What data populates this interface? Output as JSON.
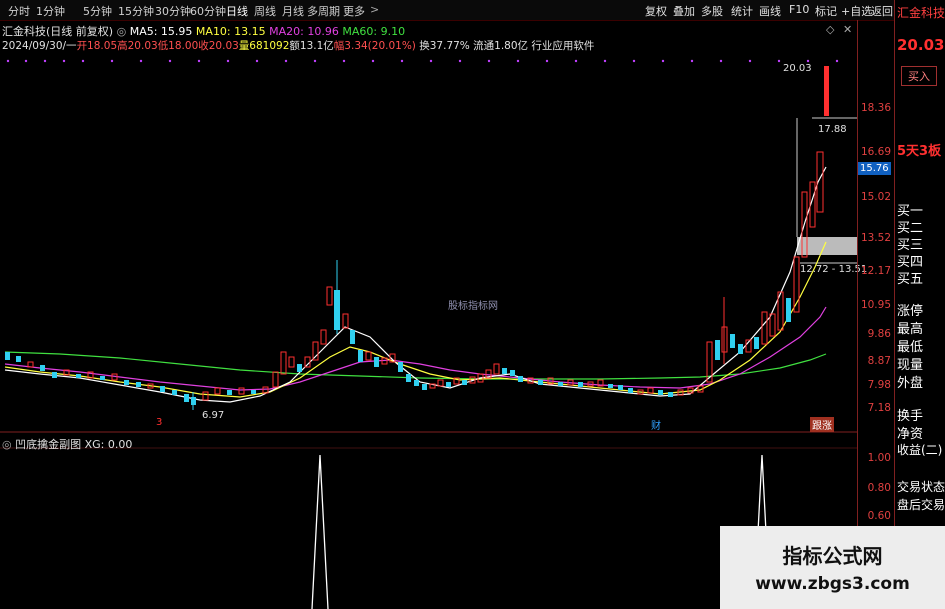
{
  "toolbar": {
    "timeframes": [
      "分时",
      "1分钟",
      "5分钟",
      "15分钟",
      "30分钟",
      "60分钟",
      "日线",
      "周线",
      "月线",
      "多周期",
      "更多"
    ],
    "active_timeframe": "日线",
    "buttons": [
      "复权",
      "叠加",
      "多股",
      "统计",
      "画线",
      "F10",
      "标记",
      "+自选",
      "返回"
    ]
  },
  "stock": {
    "name": "汇金科技",
    "period_label": "(日线 前复权)",
    "ma5": "MA5: 15.95",
    "ma10": "MA10: 13.15",
    "ma20": "MA20: 10.96",
    "ma60": "MA60: 9.10"
  },
  "stats": {
    "date": "2024/09/30/一",
    "open": "开18.05",
    "high": "高20.03",
    "low": "低18.00",
    "close": "收20.03",
    "volume": "量681092",
    "amount": "额13.1亿",
    "change": "幅3.34(20.01%)",
    "turnover": "换37.77%",
    "float_cap": "流通1.80亿",
    "industry": "行业应用软件"
  },
  "chart_labels": {
    "center_watermark": "股标指标网",
    "peak_label": "20.03",
    "low_label": "6.97",
    "box_upper": "17.88",
    "box_lower": "12.72 - 13.51",
    "current_price_tag": "15.76",
    "marker_left": "3",
    "marker_fin": "财",
    "marker_limit": "跟涨"
  },
  "price_axis": [
    "18.36",
    "16.69",
    "15.02",
    "13.52",
    "12.17",
    "10.95",
    "9.86",
    "8.87",
    "7.98",
    "7.18"
  ],
  "indicator": {
    "name": "凹底擒金副图",
    "value": "XG: 0.00",
    "axis": [
      "1.00",
      "0.80",
      "0.60"
    ]
  },
  "right_panel": {
    "stock_name": "汇金科技",
    "price": "20.03",
    "buy_button": "买入",
    "streak": "5天3板",
    "levels": [
      "买一",
      "买二",
      "买三",
      "买四",
      "买五"
    ],
    "fields": [
      "涨停",
      "最高",
      "最低",
      "现量",
      "外盘"
    ],
    "fields2": [
      "换手",
      "净资",
      "收益(二)"
    ],
    "fields3": [
      "交易状态",
      "盘后交易"
    ]
  },
  "watermark": {
    "title": "指标公式网",
    "url": "www.zbgs3.com"
  },
  "colors": {
    "up": "#ff3030",
    "down": "#30d0f0",
    "ma5": "#ffffff",
    "ma10": "#ffff40",
    "ma20": "#e040e0",
    "ma60": "#40e040"
  }
}
